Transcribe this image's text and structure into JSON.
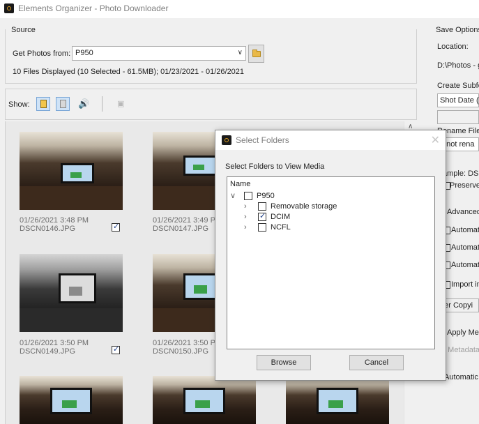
{
  "window": {
    "title": "Elements Organizer - Photo Downloader"
  },
  "source": {
    "label": "Source",
    "get_photos_label": "Get Photos from:",
    "device": "P950",
    "summary": "10 Files Displayed (10 Selected - 61.5MB); 01/23/2021 - 01/26/2021"
  },
  "toolbar": {
    "show_label": "Show:"
  },
  "thumbnails": [
    {
      "date": "01/26/2021 3:48 PM",
      "name": "DSCN0146.JPG",
      "checked": true
    },
    {
      "date": "01/26/2021 3:49 PM",
      "name": "DSCN0147.JPG",
      "checked": true
    },
    {
      "date": "01/26/2021 3:50 PM",
      "name": "DSCN0149.JPG",
      "checked": true
    },
    {
      "date": "01/26/2021 3:50 PM",
      "name": "DSCN0150.JPG",
      "checked": true
    }
  ],
  "dialog": {
    "title": "Select Folders",
    "instruction": "Select Folders to View Media",
    "column": "Name",
    "root": {
      "label": "P950",
      "checked": false
    },
    "folders": [
      {
        "label": "Removable storage",
        "checked": false
      },
      {
        "label": "DCIM",
        "checked": true
      },
      {
        "label": "NCFL",
        "checked": false
      }
    ],
    "browse_label": "Browse",
    "cancel_label": "Cancel"
  },
  "save_options": {
    "title": "Save Options",
    "location_label": "Location:",
    "location_value": "D:\\Photos - g",
    "subfolder_label": "Create Subfo",
    "subfolder_value": "Shot Date (",
    "rename_label": "Rename Files",
    "rename_value": "o not rena",
    "example_label": "ample: DS",
    "preserve_label": "Preserve",
    "advanced_label": "Advanced",
    "auto1": "Automat",
    "auto2": "Automat",
    "auto3": "Automat",
    "import_label": "Import in",
    "after_copy_label": "fter Copyi",
    "apply_meta_label": "Apply Met",
    "metadata_label": "o Metadata",
    "automatic_label": "Automatic D"
  }
}
